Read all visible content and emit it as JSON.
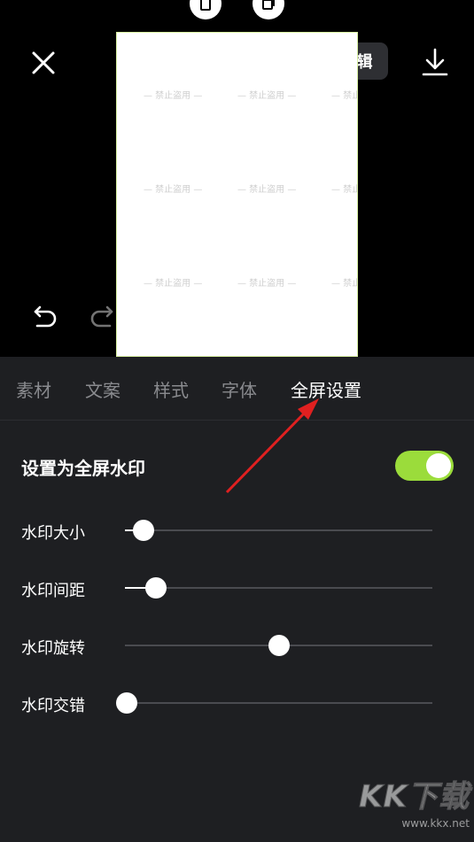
{
  "header": {
    "edit_label": "去编辑"
  },
  "canvas": {
    "watermark_text": "禁止盗用"
  },
  "tabs": [
    {
      "label": "素材"
    },
    {
      "label": "文案"
    },
    {
      "label": "样式"
    },
    {
      "label": "字体"
    },
    {
      "label": "全屏设置"
    }
  ],
  "active_tab": "全屏设置",
  "fullscreen": {
    "title": "设置为全屏水印",
    "enabled": true,
    "accent_color": "#9bdc3b"
  },
  "sliders": [
    {
      "label": "水印大小",
      "value": 0.06
    },
    {
      "label": "水印间距",
      "value": 0.1
    },
    {
      "label": "水印旋转",
      "value": 0.5
    },
    {
      "label": "水印交错",
      "value": 0.0
    }
  ],
  "annotation": {
    "arrow_color": "#e02020"
  },
  "site_watermark": {
    "brand": "KK下载",
    "url": "www.kkx.net"
  }
}
